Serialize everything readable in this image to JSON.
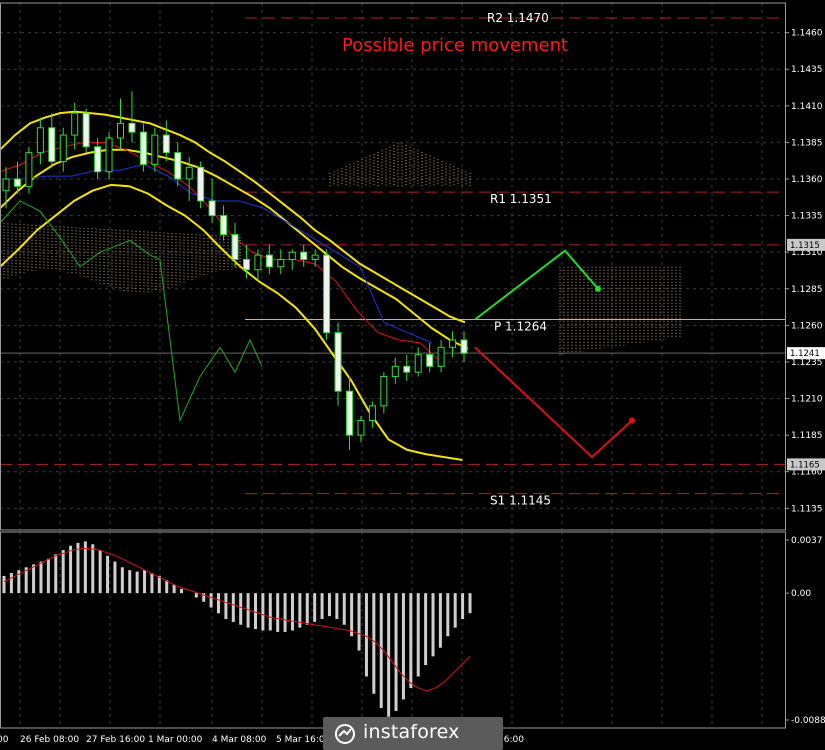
{
  "chart_data": {
    "type": "candlestick",
    "instrument_view": "EUR/USD H4 style chart with Ichimoku, Bollinger Bands and MACD",
    "title": "Possible price movement",
    "price_axis": {
      "ticks": [
        "1.1460",
        "1.1435",
        "1.1410",
        "1.1385",
        "1.1360",
        "1.1335",
        "1.1310",
        "1.1285",
        "1.1260",
        "1.1235",
        "1.1210",
        "1.1185",
        "1.1160",
        "1.1135"
      ],
      "range": [
        1.1125,
        1.1475
      ],
      "tags": [
        {
          "label": "1.1315",
          "value": 1.1315,
          "color": "#c8c8c8"
        },
        {
          "label": "1.1241",
          "value": 1.1241,
          "color": "#ffffff"
        },
        {
          "label": "1.1165",
          "value": 1.1165,
          "color": "#c8c8c8"
        }
      ]
    },
    "time_axis": {
      "labels": [
        "00",
        "26 Feb 08:00",
        "27 Feb 16:00",
        "1 Mar 00:00",
        "4 Mar 08:00",
        "5 Mar 16:00",
        "16:00"
      ]
    },
    "levels": [
      {
        "name": "R2",
        "label": "R2 1.1470",
        "value": 1.147,
        "color": "#b22222",
        "style": "dashed"
      },
      {
        "name": "R1",
        "label": "R1 1.1351",
        "value": 1.1351,
        "color": "#b22222",
        "style": "dashed"
      },
      {
        "name": "P",
        "label": "P 1.1264",
        "value": 1.1264,
        "color": "#e6a96b",
        "style": "solid"
      },
      {
        "name": "S1",
        "label": "S1 1.1145",
        "value": 1.1145,
        "color": "#b22222",
        "style": "dashed"
      },
      {
        "name": "support",
        "value": 1.1165,
        "color": "#b22222",
        "style": "dashed"
      },
      {
        "name": "resistance",
        "value": 1.1315,
        "color": "#b22222",
        "style": "dashed"
      }
    ],
    "candles": [
      [
        1.1352,
        1.1368,
        1.134,
        1.136
      ],
      [
        1.136,
        1.1372,
        1.135,
        1.1355
      ],
      [
        1.1355,
        1.1382,
        1.135,
        1.1378
      ],
      [
        1.1378,
        1.1402,
        1.137,
        1.1395
      ],
      [
        1.1395,
        1.1405,
        1.1368,
        1.1372
      ],
      [
        1.1372,
        1.1395,
        1.1365,
        1.139
      ],
      [
        1.139,
        1.1412,
        1.138,
        1.1405
      ],
      [
        1.1405,
        1.1408,
        1.1378,
        1.1382
      ],
      [
        1.1382,
        1.1388,
        1.136,
        1.1365
      ],
      [
        1.1365,
        1.1392,
        1.136,
        1.1388
      ],
      [
        1.1388,
        1.1415,
        1.138,
        1.1398
      ],
      [
        1.1398,
        1.142,
        1.1385,
        1.1392
      ],
      [
        1.1392,
        1.1398,
        1.1365,
        1.137
      ],
      [
        1.137,
        1.1395,
        1.1365,
        1.139
      ],
      [
        1.139,
        1.14,
        1.1372,
        1.1378
      ],
      [
        1.1378,
        1.1385,
        1.1355,
        1.136
      ],
      [
        1.136,
        1.1375,
        1.1345,
        1.1368
      ],
      [
        1.1368,
        1.1372,
        1.134,
        1.1345
      ],
      [
        1.1345,
        1.136,
        1.133,
        1.1335
      ],
      [
        1.1335,
        1.1342,
        1.1318,
        1.1322
      ],
      [
        1.1322,
        1.133,
        1.13,
        1.1305
      ],
      [
        1.1305,
        1.1315,
        1.1292,
        1.1298
      ],
      [
        1.1298,
        1.1312,
        1.129,
        1.1308
      ],
      [
        1.1308,
        1.1315,
        1.1295,
        1.13
      ],
      [
        1.13,
        1.1312,
        1.1295,
        1.1305
      ],
      [
        1.1305,
        1.1312,
        1.1298,
        1.131
      ],
      [
        1.131,
        1.1315,
        1.13,
        1.1305
      ],
      [
        1.1305,
        1.1312,
        1.13,
        1.1308
      ],
      [
        1.1308,
        1.1312,
        1.125,
        1.1255
      ],
      [
        1.1255,
        1.1262,
        1.1205,
        1.1215
      ],
      [
        1.1215,
        1.1225,
        1.1175,
        1.1185
      ],
      [
        1.1185,
        1.1198,
        1.118,
        1.1195
      ],
      [
        1.1195,
        1.1208,
        1.119,
        1.1205
      ],
      [
        1.1205,
        1.1228,
        1.12,
        1.1225
      ],
      [
        1.1225,
        1.1238,
        1.122,
        1.1232
      ],
      [
        1.1232,
        1.124,
        1.1222,
        1.1228
      ],
      [
        1.1228,
        1.1245,
        1.1225,
        1.124
      ],
      [
        1.124,
        1.1248,
        1.1228,
        1.1232
      ],
      [
        1.1232,
        1.125,
        1.1228,
        1.1245
      ],
      [
        1.1245,
        1.1256,
        1.1238,
        1.125
      ],
      [
        1.125,
        1.1256,
        1.1235,
        1.1241
      ]
    ],
    "bollinger_upper": [
      1.138,
      1.139,
      1.1398,
      1.1402,
      1.1405,
      1.1406,
      1.1405,
      1.1404,
      1.1402,
      1.14,
      1.1398,
      1.1394,
      1.139,
      1.1385,
      1.1378,
      1.1372,
      1.1365,
      1.1358,
      1.135,
      1.1342,
      1.1334,
      1.1325,
      1.1318,
      1.131,
      1.1302,
      1.1296,
      1.129,
      1.1284,
      1.1278,
      1.1272,
      1.1266,
      1.1262
    ],
    "bollinger_middle": [
      1.134,
      1.1352,
      1.1362,
      1.137,
      1.1375,
      1.1378,
      1.138,
      1.138,
      1.1378,
      1.1375,
      1.1372,
      1.1368,
      1.1362,
      1.1355,
      1.1348,
      1.134,
      1.133,
      1.132,
      1.131,
      1.13,
      1.1292,
      1.1285,
      1.1278,
      1.1268,
      1.1258,
      1.125,
      1.1244
    ],
    "bollinger_lower": [
      1.13,
      1.1312,
      1.1325,
      1.1335,
      1.1345,
      1.1352,
      1.1356,
      1.1355,
      1.135,
      1.1342,
      1.1335,
      1.1325,
      1.1312,
      1.13,
      1.129,
      1.1282,
      1.1272,
      1.1258,
      1.124,
      1.1222,
      1.12,
      1.1182,
      1.1175,
      1.1172,
      1.117,
      1.1168
    ],
    "forecast_paths": {
      "bullish": {
        "color": "#22dd22",
        "points": [
          [
            0,
            1.1264
          ],
          [
            1,
            1.1311
          ],
          [
            2,
            1.1285
          ]
        ]
      },
      "bearish": {
        "color": "#dd1111",
        "points": [
          [
            0,
            1.1245
          ],
          [
            1,
            1.117
          ],
          [
            2,
            1.1195
          ]
        ]
      }
    },
    "macd": {
      "ticks": [
        "0.0037",
        "0.00",
        "-0.00883"
      ],
      "histogram": [
        0.0012,
        0.0014,
        0.0016,
        0.0018,
        0.002,
        0.0022,
        0.0024,
        0.0027,
        0.003,
        0.0033,
        0.0035,
        0.0036,
        0.0034,
        0.003,
        0.0026,
        0.0022,
        0.0018,
        0.0016,
        0.0015,
        0.0016,
        0.0014,
        0.0012,
        0.0009,
        0.0006,
        0.0003,
        0.0,
        -0.0003,
        -0.0006,
        -0.001,
        -0.0014,
        -0.0018,
        -0.002,
        -0.0022,
        -0.0024,
        -0.0025,
        -0.0026,
        -0.0026,
        -0.0027,
        -0.0027,
        -0.0026,
        -0.0024,
        -0.0022,
        -0.002,
        -0.0018,
        -0.0016,
        -0.0018,
        -0.0022,
        -0.003,
        -0.004,
        -0.0058,
        -0.007,
        -0.008,
        -0.0086,
        -0.0082,
        -0.0074,
        -0.0066,
        -0.0058,
        -0.005,
        -0.0044,
        -0.0038,
        -0.003,
        -0.0024,
        -0.0018,
        -0.0014
      ],
      "signal": [
        0.0008,
        0.0011,
        0.0014,
        0.0017,
        0.002,
        0.0023,
        0.0026,
        0.0028,
        0.003,
        0.0031,
        0.0031,
        0.003,
        0.0028,
        0.0026,
        0.0023,
        0.002,
        0.0017,
        0.0014,
        0.0011,
        0.0008,
        0.0005,
        0.0003,
        0.0001,
        -0.0001,
        -0.0003,
        -0.0005,
        -0.0007,
        -0.0009,
        -0.0011,
        -0.0013,
        -0.0015,
        -0.0017,
        -0.0018,
        -0.0019,
        -0.002,
        -0.0021,
        -0.0022,
        -0.0023,
        -0.0024,
        -0.0025,
        -0.0026,
        -0.0028,
        -0.003,
        -0.0034,
        -0.004,
        -0.0048,
        -0.0056,
        -0.0062,
        -0.0066,
        -0.0068,
        -0.0066,
        -0.0062,
        -0.0056,
        -0.005,
        -0.0044
      ]
    }
  },
  "watermark": {
    "brand": "instaforex"
  }
}
